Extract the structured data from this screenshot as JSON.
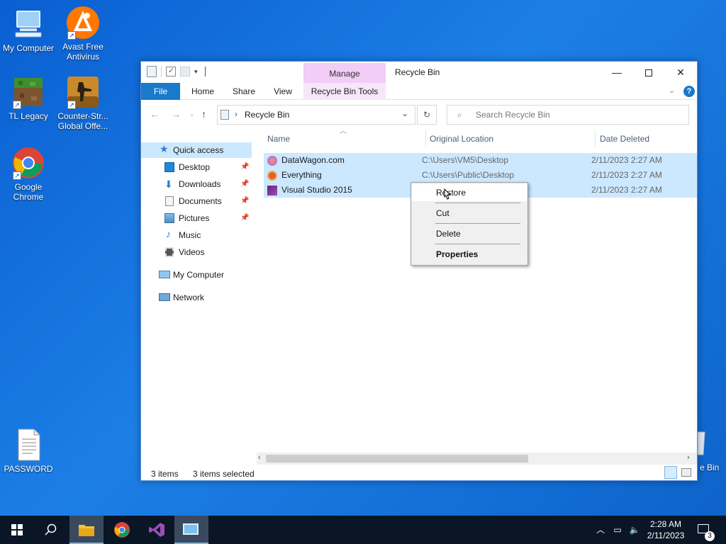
{
  "desktop": {
    "icons": [
      {
        "label": "My Computer"
      },
      {
        "label": "Avast Free Antivirus"
      },
      {
        "label": "TL Legacy"
      },
      {
        "label": "Counter-Str... Global Offe..."
      },
      {
        "label": "Google Chrome"
      },
      {
        "label": "PASSWORD"
      }
    ],
    "recycle_bin_partial": "e Bin"
  },
  "window": {
    "title": "Recycle Bin",
    "contextual_group": "Manage",
    "ribbon_tabs": [
      "File",
      "Home",
      "Share",
      "View",
      "Recycle Bin Tools"
    ],
    "address": "Recycle Bin",
    "search_placeholder": "Search Recycle Bin",
    "nav": {
      "quick_access": "Quick access",
      "items": [
        "Desktop",
        "Downloads",
        "Documents",
        "Pictures",
        "Music",
        "Videos"
      ],
      "my_computer": "My Computer",
      "network": "Network"
    },
    "columns": [
      "Name",
      "Original Location",
      "Date Deleted"
    ],
    "files": [
      {
        "name": "DataWagon.com",
        "location": "C:\\Users\\VM5\\Desktop",
        "date": "2/11/2023 2:27 AM"
      },
      {
        "name": "Everything",
        "location": "C:\\Users\\Public\\Desktop",
        "date": "2/11/2023 2:27 AM"
      },
      {
        "name": "Visual Studio 2015",
        "location": "",
        "date": "2/11/2023 2:27 AM"
      }
    ],
    "status": {
      "count": "3 items",
      "selected": "3 items selected"
    }
  },
  "context_menu": {
    "restore": "Restore",
    "cut": "Cut",
    "delete": "Delete",
    "properties": "Properties"
  },
  "taskbar": {
    "time": "2:28 AM",
    "date": "2/11/2023",
    "notifications": "3"
  },
  "colors": {
    "accent": "#1979ca",
    "selection": "#cce8ff",
    "manage_tab": "#f2cdf5"
  }
}
